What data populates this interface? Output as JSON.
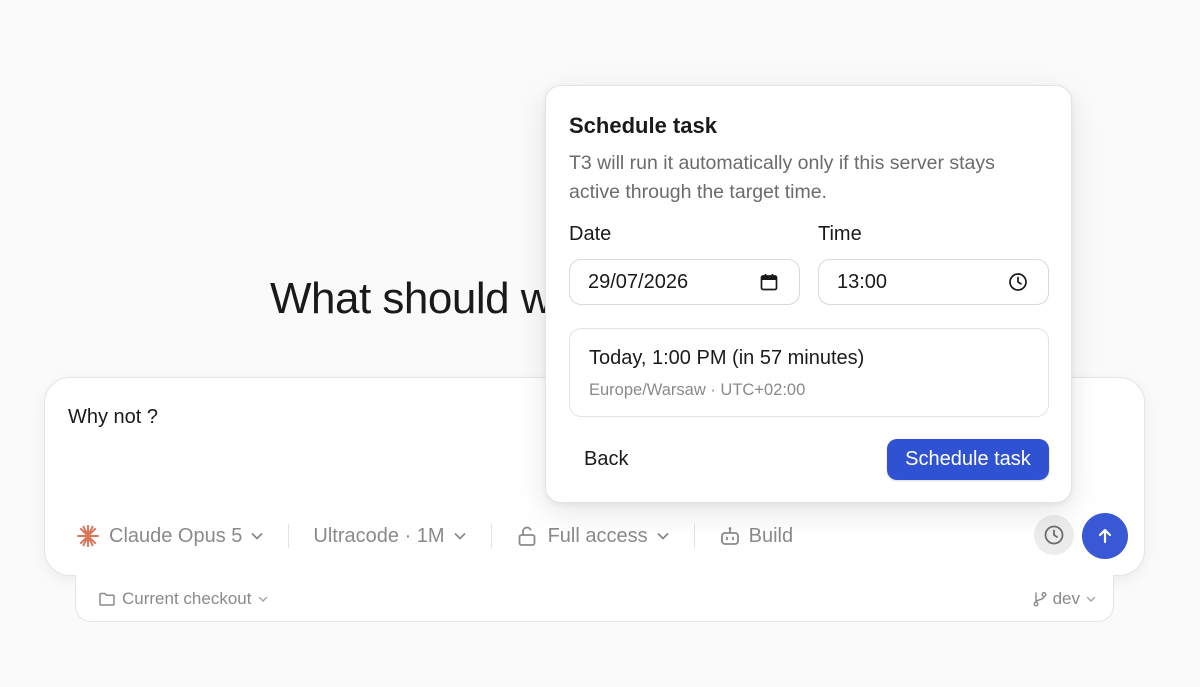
{
  "main": {
    "heading": "What should w"
  },
  "composer": {
    "prompt": "Why not ?",
    "toolbar": {
      "model_label": "Claude Opus 5",
      "mode_label": "Ultracode · 1M",
      "access_label": "Full access",
      "build_label": "Build"
    },
    "icons": {
      "model": "sparkle-icon",
      "access": "unlock-icon",
      "build": "robot-icon",
      "schedule": "clock-icon",
      "send": "arrow-up-icon"
    }
  },
  "subbar": {
    "checkout_label": "Current checkout",
    "branch_label": "dev"
  },
  "popover": {
    "title": "Schedule task",
    "description": "T3 will run it automatically only if this server stays active through the target time.",
    "date_label": "Date",
    "date_value": "29/07/2026",
    "time_label": "Time",
    "time_value": "13:00",
    "summary_main": "Today, 1:00 PM (in 57 minutes)",
    "summary_sub": "Europe/Warsaw · UTC+02:00",
    "back_label": "Back",
    "schedule_label": "Schedule task"
  },
  "colors": {
    "accent": "#2f52d3",
    "send": "#3858d6",
    "brand_claude": "#d97757"
  }
}
